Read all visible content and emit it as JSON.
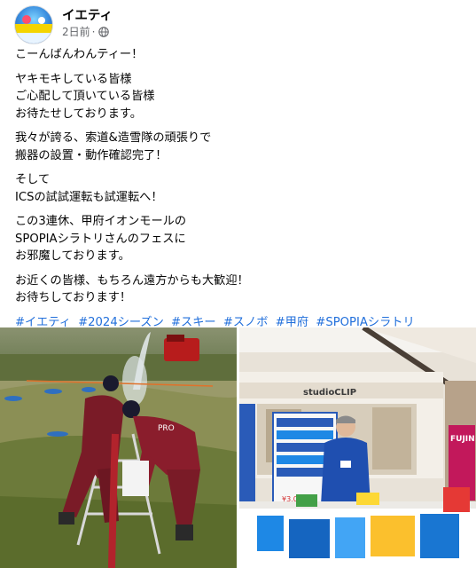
{
  "post": {
    "author": "イエティ",
    "time": "2日前",
    "paragraphs": [
      "こーんばんわんティー！",
      "ヤキモキしている皆様\nご心配して頂いている皆様\nお待たせしております。",
      "我々が誇る、索道&造雪隊の頑張りで\n搬器の設置・動作確認完了！",
      "そして\nICSの試試運転も試運転へ！",
      "この3連休、甲府イオンモールの\nSPOPIAシラトリさんのフェスに\nお邪魔しております。",
      "お近くの皆様、もちろん遠方からも大歓迎！\nお待ちしております！"
    ],
    "hashtags": [
      "#イエティ",
      "#2024シーズン",
      "#スキー",
      "#スノボ",
      "#甲府",
      "#SPOPIAシラトリ"
    ]
  },
  "photos": {
    "left": {
      "jacket_text": "PRO"
    },
    "right": {
      "store_sign": "studioCLIP",
      "banner": "FUJIN",
      "price": "¥3,000"
    }
  },
  "colors": {
    "link": "#216fdb",
    "muted": "#65676b",
    "text": "#050505"
  },
  "icons": {
    "visibility": "globe-icon"
  }
}
